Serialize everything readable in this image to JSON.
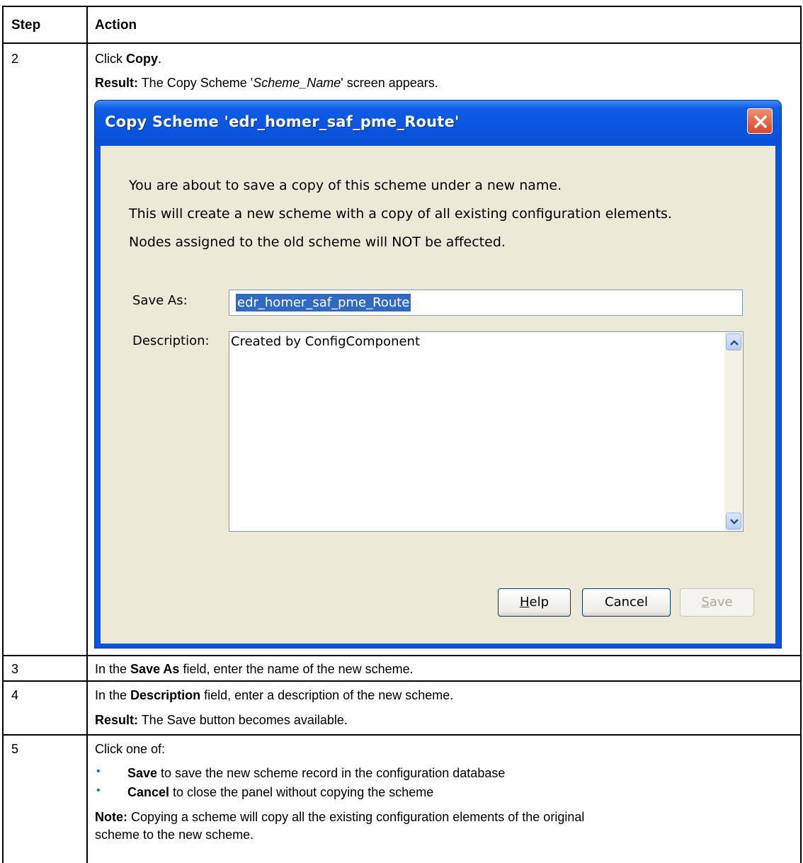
{
  "table": {
    "header": {
      "step": "Step",
      "action": "Action"
    },
    "rows": [
      {
        "step": "2",
        "line1_prefix": "Click ",
        "line1_bold": "Copy",
        "line1_suffix": ".",
        "result_label": "Result:",
        "result_text_a": " The Copy Scheme '",
        "result_italic": "Scheme_Name",
        "result_text_b": "' screen appears."
      },
      {
        "step": "3",
        "prefix": "In the ",
        "bold": "Save As",
        "suffix": " field, enter the name of the new scheme."
      },
      {
        "step": "4",
        "prefix": "In the ",
        "bold": "Description",
        "suffix": " field, enter a description of the new scheme.",
        "result_label": "Result:",
        "result_text": " The Save button becomes available."
      },
      {
        "step": "5",
        "intro": "Click one of:",
        "bullets": [
          {
            "bold": "Save",
            "text": " to save the new scheme record in the configuration database"
          },
          {
            "bold": "Cancel",
            "text": " to close the panel without copying the scheme"
          }
        ],
        "note_label": "Note:",
        "note_text_1": " Copying a scheme will copy all the existing configuration elements of the original",
        "note_text_2": "scheme to the new scheme."
      }
    ]
  },
  "dialog": {
    "title": "Copy Scheme 'edr_homer_saf_pme_Route'",
    "messages": [
      "You are about to save a copy of this scheme under a new name.",
      "This will create a new scheme with a copy of all existing configuration elements.",
      "Nodes assigned to the old scheme will NOT be affected."
    ],
    "save_as_label": "Save As:",
    "save_as_value": "edr_homer_saf_pme_Route",
    "description_label": "Description:",
    "description_value": "Created by ConfigComponent",
    "buttons": {
      "help_mnemonic": "H",
      "help_rest": "elp",
      "cancel": "Cancel",
      "save_mnemonic": "S",
      "save_rest": "ave"
    },
    "colors": {
      "titlebar": "#0a55e0",
      "body": "#ece9d8",
      "selection": "#316ac5",
      "close": "#d9462a"
    }
  }
}
